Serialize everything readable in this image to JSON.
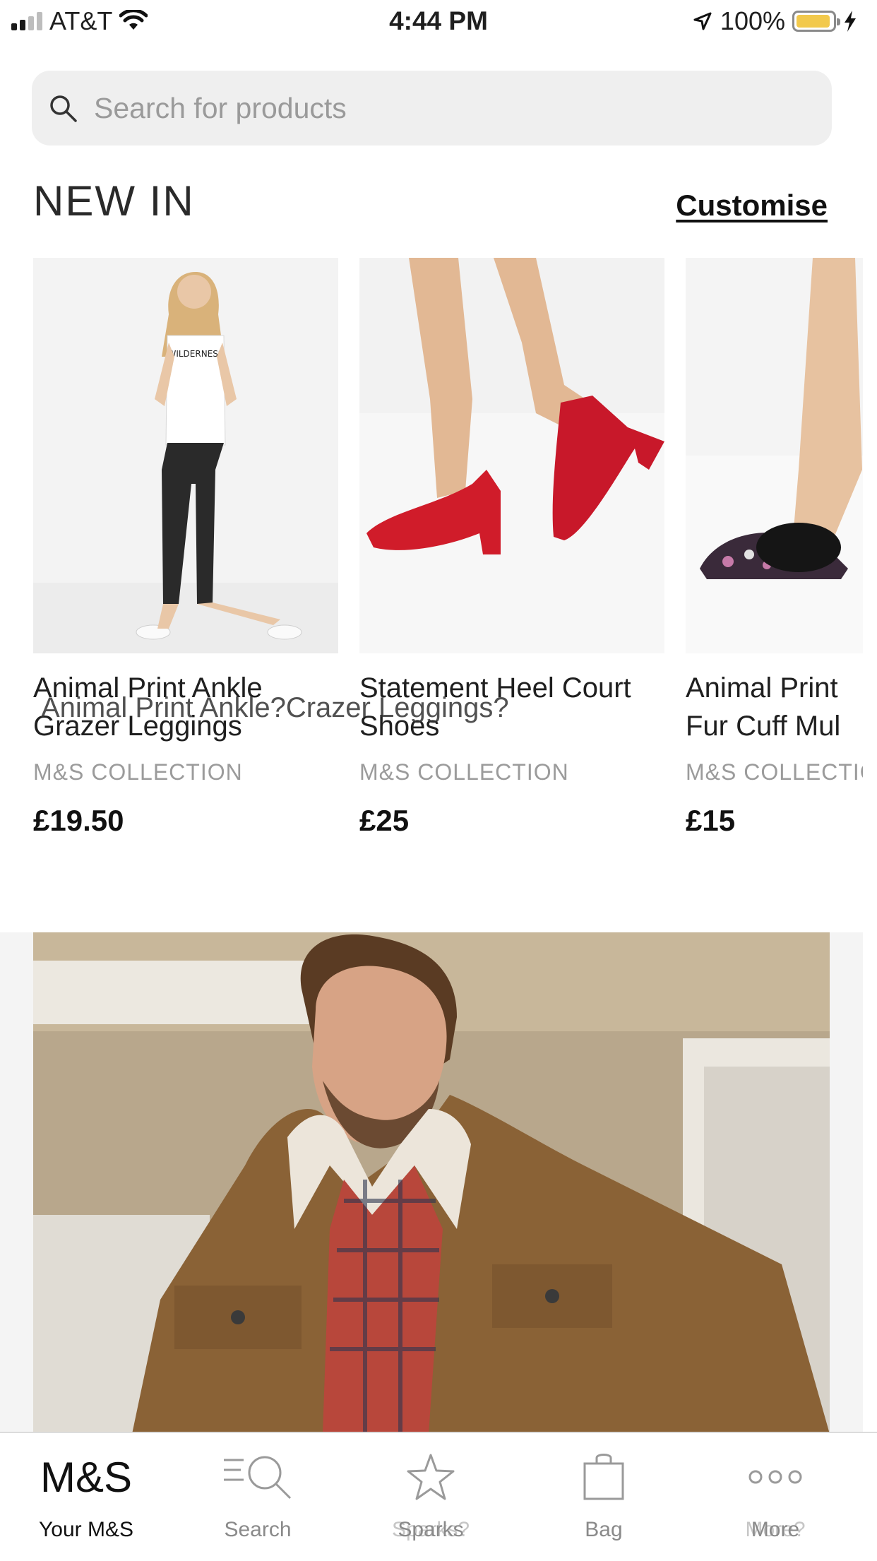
{
  "status_bar": {
    "carrier": "AT&T",
    "time": "4:44 PM",
    "battery": "100%"
  },
  "search": {
    "placeholder": "Search for products"
  },
  "section": {
    "title": "NEW IN",
    "action": "Customise"
  },
  "products": [
    {
      "name": "Animal Print Ankle Grazer Leggings",
      "brand": "M&S COLLECTION",
      "price": "£19.50"
    },
    {
      "name": "Statement Heel Court Shoes",
      "brand": "M&S COLLECTION",
      "price": "£25"
    },
    {
      "name": "Animal Print Fur Cuff Mul",
      "brand": "M&S COLLECTIO",
      "price": "£15"
    }
  ],
  "overlay_text": "Animal Print Ankle?Crazer Leggings?",
  "tabs": [
    {
      "label": "Your M&S",
      "logo": "M&S",
      "icon": "ms-logo",
      "active": true
    },
    {
      "label": "Search",
      "icon": "search-list-icon"
    },
    {
      "label": "Sparks",
      "ghost": "Sparks?",
      "icon": "star-icon"
    },
    {
      "label": "Bag",
      "icon": "bag-icon"
    },
    {
      "label": "More",
      "ghost": "More?",
      "icon": "more-dots-icon"
    }
  ],
  "colors": {
    "search_bg": "#efefef",
    "battery": "#f2c94c",
    "inactive_tab": "#8a8a8a"
  }
}
